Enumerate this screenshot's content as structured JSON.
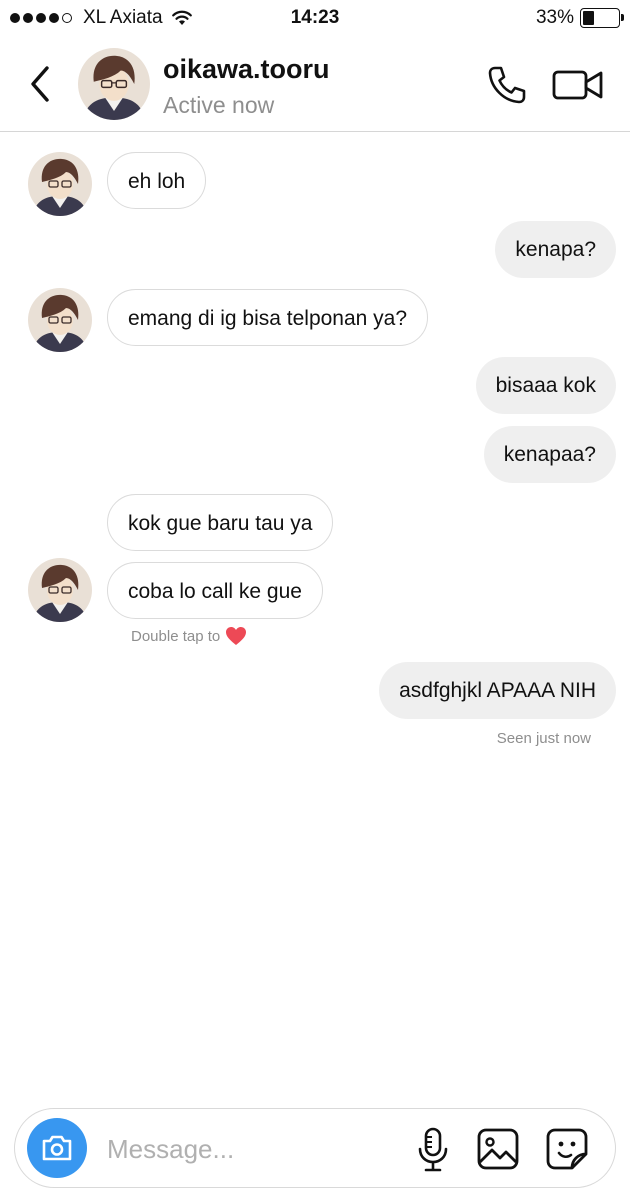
{
  "status_bar": {
    "carrier": "XL Axiata",
    "time": "14:23",
    "battery_percent": "33%",
    "battery_level": 0.33,
    "signal_bars_filled": 4,
    "signal_bars_total": 5
  },
  "header": {
    "username": "oikawa.tooru",
    "status": "Active now"
  },
  "messages": [
    {
      "direction": "in",
      "text": "eh loh"
    },
    {
      "direction": "out",
      "text": "kenapa?"
    },
    {
      "direction": "in",
      "text": "emang di ig bisa telponan ya?"
    },
    {
      "direction": "out",
      "text": "bisaaa kok"
    },
    {
      "direction": "out",
      "text": "kenapaa?"
    },
    {
      "direction": "in",
      "text": "kok gue baru tau ya"
    },
    {
      "direction": "in",
      "text": "coba lo call ke gue"
    },
    {
      "direction": "out",
      "text": "asdfghjkl APAAA NIH"
    }
  ],
  "hints": {
    "double_tap": "Double tap to",
    "seen": "Seen just now"
  },
  "composer": {
    "placeholder": "Message..."
  },
  "colors": {
    "accent": "#3897f0",
    "outgoing_bubble": "#efefef",
    "incoming_border": "#dbdbdb",
    "muted_text": "#8e8e8e",
    "heart": "#ed4956"
  },
  "icons": [
    "back-chevron-icon",
    "phone-icon",
    "video-camera-icon",
    "camera-icon",
    "microphone-icon",
    "gallery-icon",
    "sticker-icon",
    "heart-icon",
    "wifi-icon",
    "battery-icon"
  ]
}
